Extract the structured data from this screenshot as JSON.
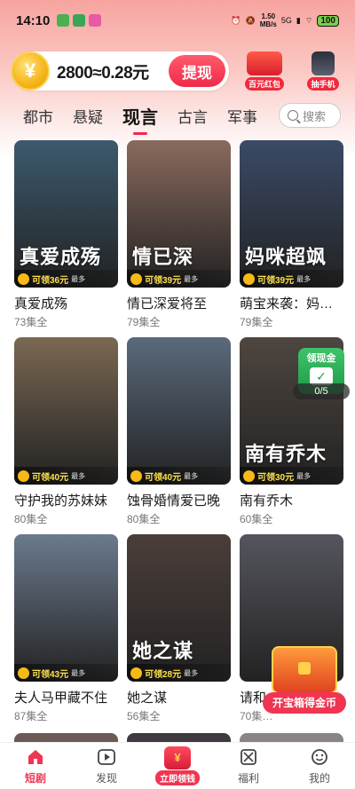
{
  "status_bar": {
    "time": "14:10",
    "speed_value": "1.50",
    "speed_unit": "MB/s",
    "network": "5G",
    "battery": "100"
  },
  "header": {
    "coin_amount": "2800≈0.28元",
    "withdraw_label": "提现",
    "promo_red_packet": "百元红包",
    "promo_phone": "抽手机"
  },
  "tabs": {
    "items": [
      "都市",
      "悬疑",
      "现言",
      "古言",
      "军事"
    ],
    "active_index": 2,
    "search_placeholder": "搜索"
  },
  "dramas": [
    {
      "title": "真爱成殇",
      "episodes": "73集全",
      "poster_text": "真爱成殇",
      "reward": "可领36元",
      "reward_suffix": "最多",
      "color": "#3c5a6e"
    },
    {
      "title": "情已深爱将至",
      "episodes": "79集全",
      "poster_text": "情已深",
      "reward": "可领39元",
      "reward_suffix": "最多",
      "color": "#8a6a5e"
    },
    {
      "title": "萌宝来袭：妈…",
      "episodes": "79集全",
      "poster_text": "妈咪超飒",
      "reward": "可领39元",
      "reward_suffix": "最多",
      "color": "#3a4a66"
    },
    {
      "title": "守护我的苏妹妹",
      "episodes": "80集全",
      "poster_text": "",
      "reward": "可领40元",
      "reward_suffix": "最多",
      "color": "#7a6852"
    },
    {
      "title": "蚀骨婚情爱已晚",
      "episodes": "80集全",
      "poster_text": "",
      "reward": "可领40元",
      "reward_suffix": "最多",
      "color": "#5a6a7c"
    },
    {
      "title": "南有乔木",
      "episodes": "60集全",
      "poster_text": "南有乔木",
      "reward": "可领30元",
      "reward_suffix": "最多",
      "color": "#4e4640"
    },
    {
      "title": "夫人马甲藏不住",
      "episodes": "87集全",
      "poster_text": "",
      "reward": "可领43元",
      "reward_suffix": "最多",
      "color": "#6b7a8e"
    },
    {
      "title": "她之谋",
      "episodes": "56集全",
      "poster_text": "她之谋",
      "reward": "可领28元",
      "reward_suffix": "最多",
      "color": "#4a3e3a"
    },
    {
      "title": "请和…",
      "episodes": "70集…",
      "poster_text": "",
      "reward": "",
      "reward_suffix": "",
      "color": "#55555e"
    }
  ],
  "widgets": {
    "task_label": "领现金",
    "task_progress": "0/5",
    "treasure_label": "开宝箱得金币"
  },
  "bottom_nav": {
    "items": [
      "短剧",
      "发现",
      "立即领钱",
      "福利",
      "我的"
    ],
    "active_index": 0
  },
  "colors": {
    "accent": "#f03552",
    "header_gradient_top": "#f7a4a0",
    "reward_text": "#ffe14d"
  }
}
